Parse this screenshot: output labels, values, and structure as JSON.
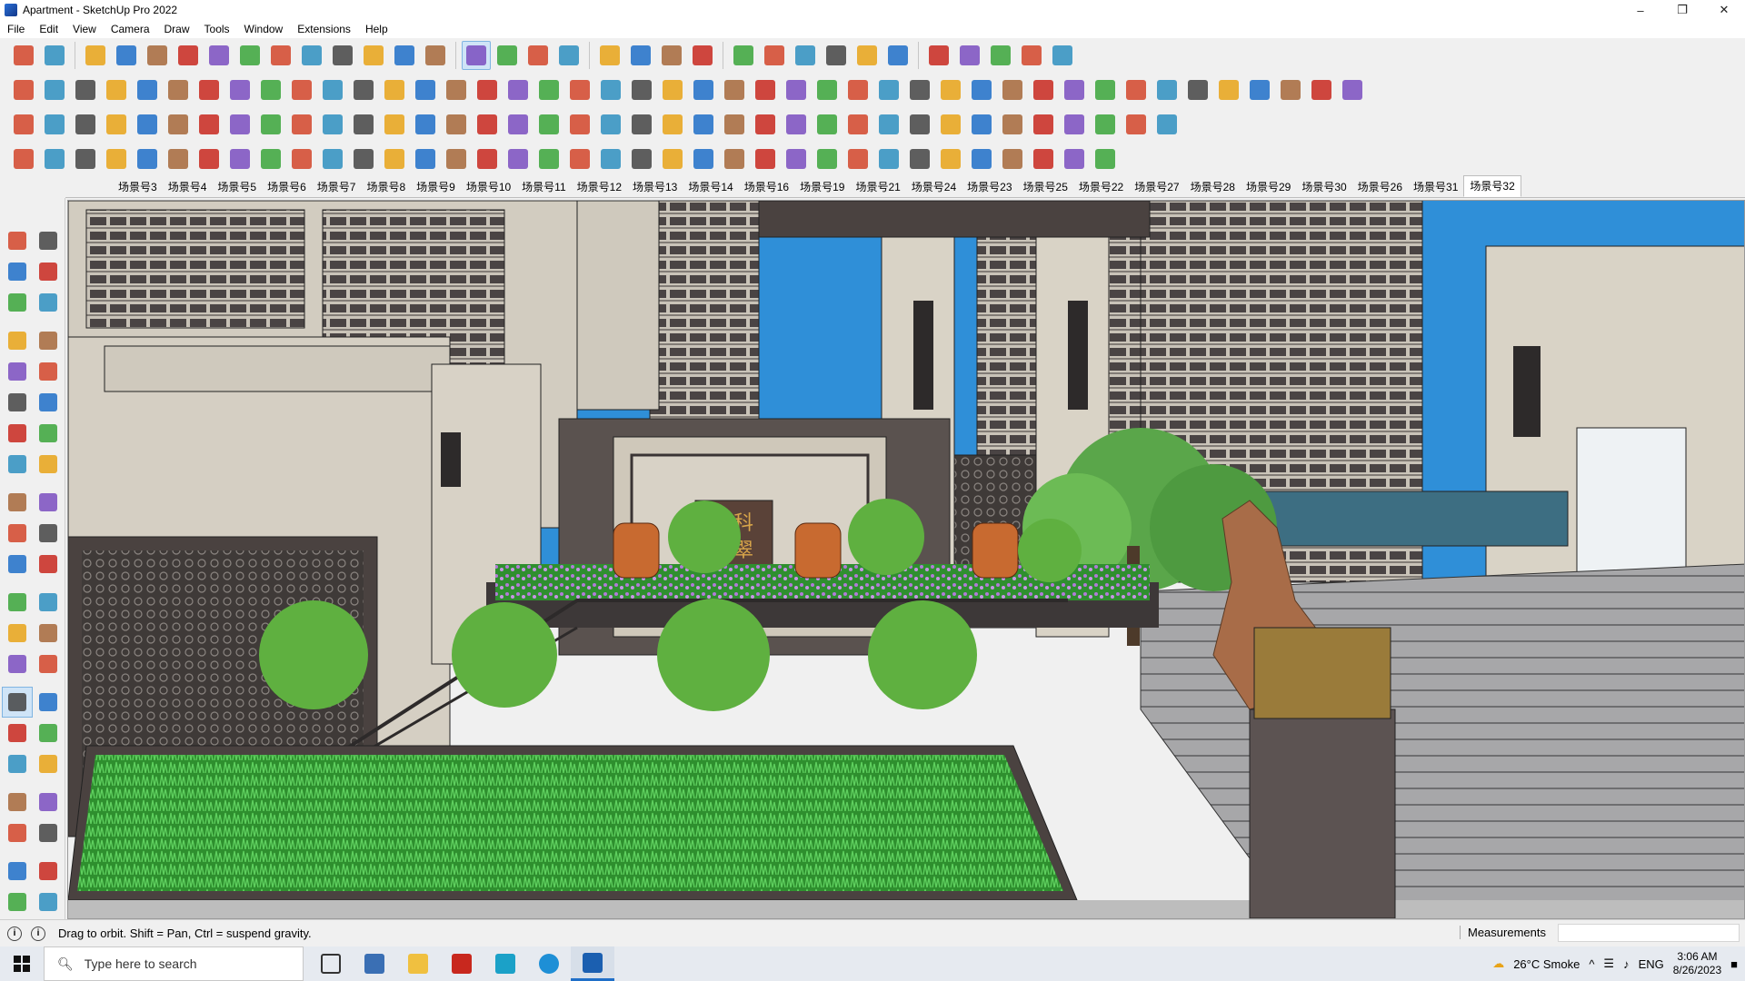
{
  "window": {
    "title": "Apartment - SketchUp Pro 2022",
    "controls": [
      "–",
      "❐",
      "✕"
    ]
  },
  "menu": [
    "File",
    "Edit",
    "View",
    "Camera",
    "Draw",
    "Tools",
    "Window",
    "Extensions",
    "Help"
  ],
  "scenes": {
    "tabs": [
      "场景号3",
      "场景号4",
      "场景号5",
      "场景号6",
      "场景号7",
      "场景号8",
      "场景号9",
      "场景号10",
      "场景号11",
      "场景号12",
      "场景号13",
      "场景号14",
      "场景号16",
      "场景号19",
      "场景号21",
      "场景号24",
      "场景号23",
      "场景号25",
      "场景号22",
      "场景号27",
      "场景号28",
      "场景号29",
      "场景号30",
      "场景号26",
      "场景号31",
      "场景号32"
    ],
    "active": "场景号32"
  },
  "toolbar_icons": {
    "row1": [
      "zoom-window-icon",
      "select-icon",
      "eraser-icon",
      "pencil-icon",
      "lasso-icon",
      "rectangle-icon",
      "push-pull-icon",
      "follow-me-icon",
      "move-icon",
      "rotate-icon",
      "scale-icon",
      "tape-icon",
      "text-icon",
      "paint-icon",
      "orbit-icon",
      "pan-icon",
      "zoom-icon",
      "zoom-extents-icon",
      "styles-icon",
      "section-icon",
      "layers-icon",
      "outliner-icon",
      "user-icon",
      "components-icon",
      "materials-icon",
      "sandbox-icon",
      "axes-up-icon",
      "axes-down-icon",
      "dimension-icon",
      "extents-icon",
      "undo-icon",
      "redo-icon",
      "warehouse-icon"
    ],
    "row2_count": 44,
    "row3_count": 38,
    "row4_count": 36
  },
  "left_tools": [
    "select-icon",
    "orbit-icon",
    "paint-icon",
    "eraser-icon",
    "components-icon",
    "tape-icon",
    "line-icon",
    "freehand-icon",
    "rectangle-icon",
    "rotated-rect-icon",
    "circle-icon",
    "polygon-icon",
    "arc-icon",
    "pie-icon",
    "2pt-arc-icon",
    "3pt-arc-icon",
    "move-icon",
    "push-pull-icon",
    "rotate-icon",
    "follow-me-icon",
    "scale-icon",
    "offset-icon",
    "tape-measure-icon",
    "dimension-icon",
    "protractor-icon",
    "text-icon",
    "axes-icon",
    "3d-text-icon",
    "orbit-active-icon",
    "pan-icon",
    "zoom-icon",
    "zoom-window-icon",
    "zoom-extents-icon",
    "previous-icon",
    "walk-icon",
    "look-around-icon",
    "position-camera-icon",
    "section-plane-icon",
    "display-section-icon",
    "section-fill-icon",
    "layers-a-icon",
    "layers-b-icon"
  ],
  "viewport": {
    "sign_text_line1": "万科",
    "sign_text_line2": "翡翠"
  },
  "status": {
    "hint": "Drag to orbit. Shift = Pan, Ctrl = suspend gravity.",
    "measurements_label": "Measurements",
    "measurements_value": ""
  },
  "taskbar": {
    "search_placeholder": "Type here to search",
    "weather": "26°C  Smoke",
    "lang": "ENG",
    "time": "3:06 AM",
    "date": "8/26/2023"
  },
  "colors": {
    "accent": "#1f6fc8",
    "active_tool": "#cfe4f7",
    "sky": "#2f8fd8",
    "stone": "#d9d3c6",
    "dark_frame": "#4a4240",
    "grass": "#3aa53a",
    "flowers": "#b07ad8"
  }
}
